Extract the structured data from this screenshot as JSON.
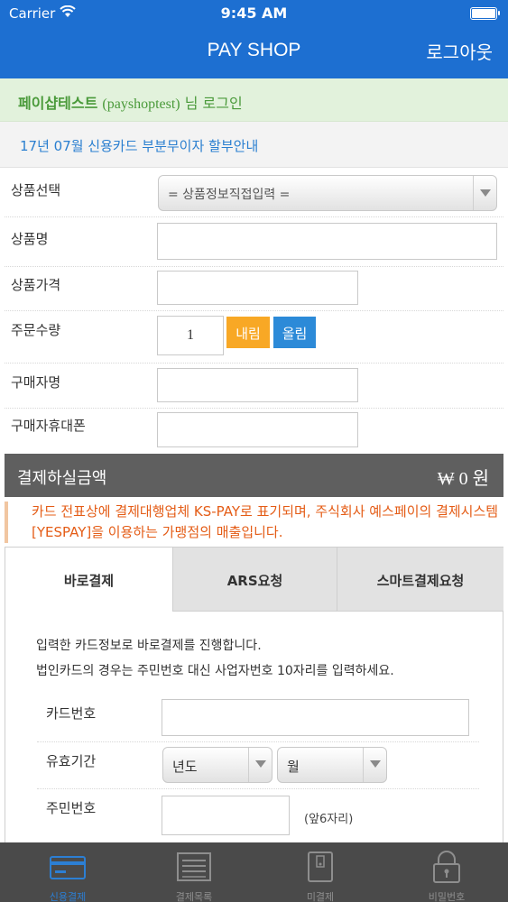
{
  "status_bar": {
    "carrier": "Carrier",
    "time": "9:45 AM"
  },
  "nav": {
    "title": "PAY SHOP",
    "logout": "로그아웃"
  },
  "login": {
    "shop_name": "페이샵테스트",
    "user_id": "(payshoptest)",
    "suffix": "님 로그인"
  },
  "notice": {
    "text": "17년 07월 신용카드 부분무이자 할부안내"
  },
  "form": {
    "product_select": {
      "label": "상품선택",
      "value": "= 상품정보직접입력 ="
    },
    "product_name": {
      "label": "상품명",
      "value": ""
    },
    "product_price": {
      "label": "상품가격",
      "value": ""
    },
    "order_qty": {
      "label": "주문수량",
      "value": "1",
      "down_label": "내림",
      "up_label": "올림"
    },
    "buyer_name": {
      "label": "구매자명",
      "value": ""
    },
    "buyer_phone": {
      "label": "구매자휴대폰",
      "value": ""
    }
  },
  "amount": {
    "label": "결제하실금액",
    "currency_symbol": "₩",
    "value": "0",
    "unit": "원"
  },
  "info": {
    "text": "카드 전표상에 결제대행업체 KS-PAY로 표기되며, 주식회사 예스페이의 결제시스템 [YESPAY]을 이용하는 가맹점의 매출입니다."
  },
  "payment_tabs": {
    "tabs": [
      {
        "label": "바로결제",
        "active": true
      },
      {
        "label": "ARS요청",
        "active": false
      },
      {
        "label": "스마트결제요청",
        "active": false
      }
    ],
    "description_line1": "입력한 카드정보로 바로결제를 진행합니다.",
    "description_line2": "법인카드의 경우는 주민번호 대신 사업자번호 10자리를 입력하세요.",
    "card_number": {
      "label": "카드번호",
      "value": ""
    },
    "expiry": {
      "label": "유효기간",
      "year_value": "년도",
      "month_value": "월"
    },
    "ssn": {
      "label": "주민번호",
      "value": "",
      "hint": "(앞6자리)"
    }
  },
  "tab_bar": {
    "items": [
      {
        "label": "신용결제",
        "icon": "card-icon",
        "active": true
      },
      {
        "label": "결제목록",
        "icon": "list-icon",
        "active": false
      },
      {
        "label": "미결제",
        "icon": "phone-icon",
        "active": false
      },
      {
        "label": "비밀번호",
        "icon": "lock-icon",
        "active": false
      }
    ]
  },
  "colors": {
    "accent": "#1d6fd1",
    "down_button": "#f8a825",
    "up_button": "#2c8ad8",
    "info_text": "#e45c16"
  }
}
